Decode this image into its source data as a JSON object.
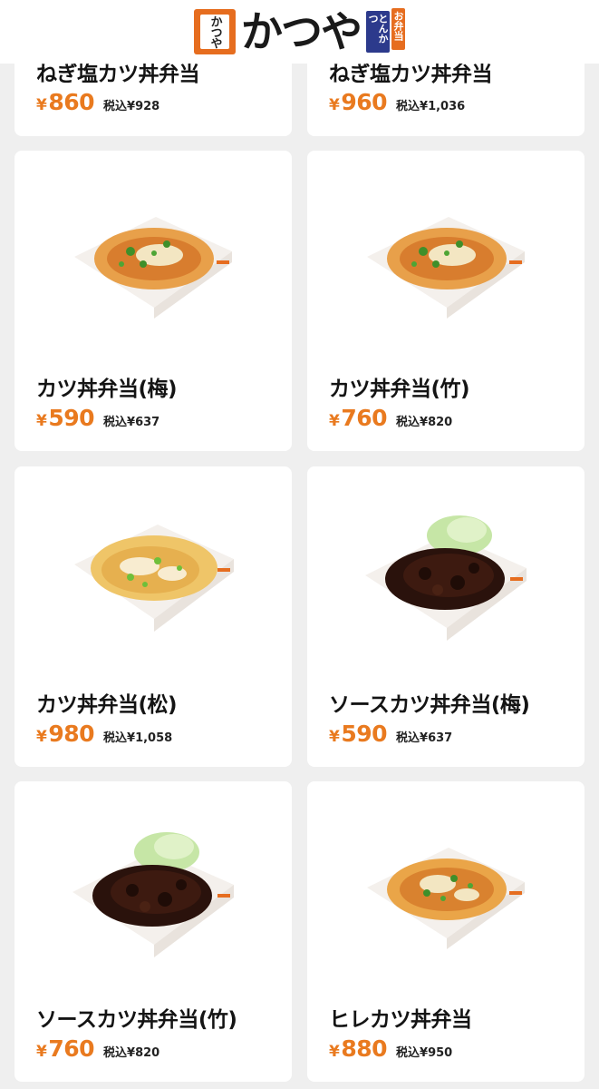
{
  "header": {
    "logo_text": "かつや",
    "logo_box_text": "かつや",
    "logo_tag_1": "とんかつ",
    "logo_tag_2": "お弁当"
  },
  "products": [
    {
      "name": "ねぎ塩カツ丼弁当",
      "currency": "¥",
      "price": "860",
      "tax_label": "税込¥928",
      "style": "none"
    },
    {
      "name": "ねぎ塩カツ丼弁当",
      "currency": "¥",
      "price": "960",
      "tax_label": "税込¥1,036",
      "style": "none"
    },
    {
      "name": "カツ丼弁当(梅)",
      "currency": "¥",
      "price": "590",
      "tax_label": "税込¥637",
      "style": "katsudon"
    },
    {
      "name": "カツ丼弁当(竹)",
      "currency": "¥",
      "price": "760",
      "tax_label": "税込¥820",
      "style": "katsudon"
    },
    {
      "name": "カツ丼弁当(松)",
      "currency": "¥",
      "price": "980",
      "tax_label": "税込¥1,058",
      "style": "katsudon-light"
    },
    {
      "name": "ソースカツ丼弁当(梅)",
      "currency": "¥",
      "price": "590",
      "tax_label": "税込¥637",
      "style": "sauce"
    },
    {
      "name": "ソースカツ丼弁当(竹)",
      "currency": "¥",
      "price": "760",
      "tax_label": "税込¥820",
      "style": "sauce"
    },
    {
      "name": "ヒレカツ丼弁当",
      "currency": "¥",
      "price": "880",
      "tax_label": "税込¥950",
      "style": "katsudon"
    }
  ],
  "colors": {
    "accent": "#e97a1f",
    "brand_orange": "#e66d1f",
    "brand_blue": "#2c3a8c",
    "background": "#efefef"
  }
}
